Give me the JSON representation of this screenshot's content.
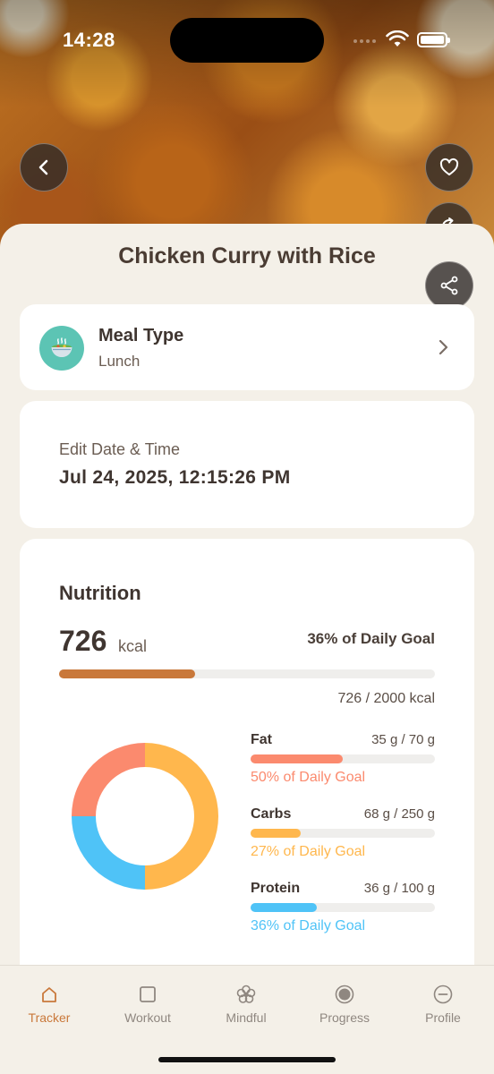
{
  "status": {
    "time": "14:28"
  },
  "meal": {
    "title": "Chicken Curry with Rice",
    "type_label": "Meal Type",
    "type_value": "Lunch"
  },
  "datetime": {
    "label": "Edit Date & Time",
    "value": "Jul 24, 2025, 12:15:26 PM"
  },
  "nutrition": {
    "title": "Nutrition",
    "calories": "726",
    "calories_unit": "kcal",
    "goal_percent_text": "36% of Daily Goal",
    "goal_fraction": 0.363,
    "ratio_text": "726 / 2000 kcal",
    "macros": [
      {
        "name": "Fat",
        "amount": "35 g / 70 g",
        "goal_text": "50% of Daily Goal",
        "fraction": 0.5,
        "color": "#fb8a6e"
      },
      {
        "name": "Carbs",
        "amount": "68 g / 250 g",
        "goal_text": "27% of Daily Goal",
        "fraction": 0.27,
        "color": "#ffb74d"
      },
      {
        "name": "Protein",
        "amount": "36 g / 100 g",
        "goal_text": "36% of Daily Goal",
        "fraction": 0.36,
        "color": "#4fc3f7"
      }
    ]
  },
  "chart_data": {
    "type": "pie",
    "categories": [
      "Carbs",
      "Protein",
      "Fat"
    ],
    "values": [
      50,
      25,
      25
    ],
    "colors": [
      "#ffb74d",
      "#4fc3f7",
      "#fb8a6e"
    ]
  },
  "colors": {
    "accent": "#c9783a",
    "teal": "#5cc4b4"
  },
  "tabs": [
    {
      "label": "Tracker",
      "icon": "house-icon",
      "active": true
    },
    {
      "label": "Workout",
      "icon": "square-icon",
      "active": false
    },
    {
      "label": "Mindful",
      "icon": "flower-icon",
      "active": false
    },
    {
      "label": "Progress",
      "icon": "target-icon",
      "active": false
    },
    {
      "label": "Profile",
      "icon": "minus-circle-icon",
      "active": false
    }
  ]
}
